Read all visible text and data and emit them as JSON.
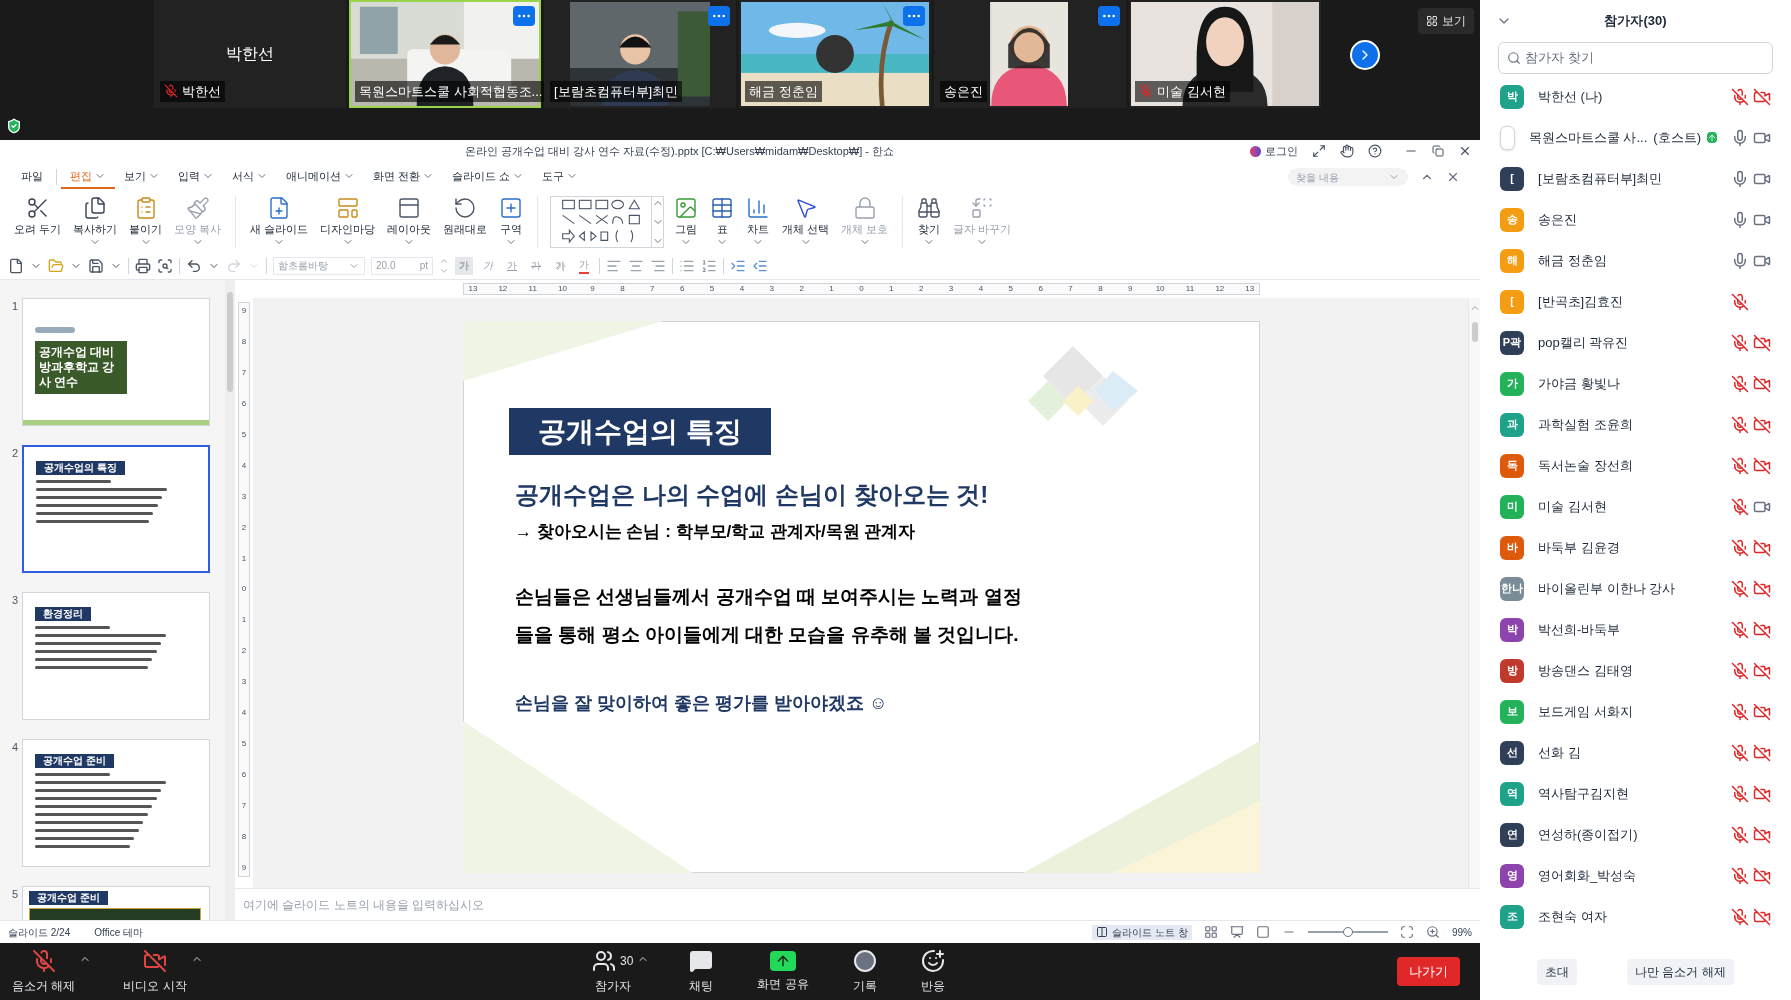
{
  "video_strip": {
    "tiles": [
      {
        "kind": "name",
        "name": "박한선",
        "label": "박한선",
        "muted": true,
        "speaking": false,
        "menu": false
      },
      {
        "kind": "video",
        "label": "목원스마트스쿨 사회적협동조...",
        "muted": false,
        "speaking": true,
        "menu": true
      },
      {
        "kind": "video",
        "label": "[보람초컴퓨터부]최민",
        "muted": false,
        "speaking": false,
        "menu": true
      },
      {
        "kind": "video",
        "label": "해금 정춘임",
        "muted": false,
        "speaking": false,
        "menu": true
      },
      {
        "kind": "video",
        "label": "송은진",
        "muted": false,
        "speaking": false,
        "menu": true
      },
      {
        "kind": "video",
        "label": "미술 김서현",
        "muted": true,
        "speaking": false,
        "menu": false
      }
    ],
    "view_button": "보기"
  },
  "app": {
    "title": "온라인 공개수업 대비 강사 연수 자료(수정).pptx [C:₩Users₩midam₩Desktop₩] - 한쇼",
    "login": "로그인",
    "search_placeholder": "찾을 내용"
  },
  "menu_tabs": [
    {
      "label": "파일",
      "selected": false
    },
    {
      "label": "편집",
      "selected": true
    },
    {
      "label": "보기",
      "selected": false
    },
    {
      "label": "입력",
      "selected": false
    },
    {
      "label": "서식",
      "selected": false
    },
    {
      "label": "애니메이션",
      "selected": false
    },
    {
      "label": "화면 전환",
      "selected": false
    },
    {
      "label": "슬라이드 쇼",
      "selected": false
    },
    {
      "label": "도구",
      "selected": false
    }
  ],
  "ribbon": [
    {
      "kind": "button",
      "label": "오려 두기",
      "disabled": false,
      "dropdown": false
    },
    {
      "kind": "button",
      "label": "복사하기",
      "disabled": false,
      "dropdown": true
    },
    {
      "kind": "button",
      "label": "붙이기",
      "disabled": false,
      "dropdown": true
    },
    {
      "kind": "button",
      "label": "모양 복사",
      "disabled": true,
      "dropdown": true
    },
    {
      "kind": "separator"
    },
    {
      "kind": "button",
      "label": "새 슬라이드",
      "disabled": false,
      "dropdown": true
    },
    {
      "kind": "button",
      "label": "디자인마당",
      "disabled": false,
      "dropdown": true
    },
    {
      "kind": "button",
      "label": "레이아웃",
      "disabled": false,
      "dropdown": true
    },
    {
      "kind": "button",
      "label": "원래대로",
      "disabled": false,
      "dropdown": false
    },
    {
      "kind": "button",
      "label": "구역",
      "disabled": false,
      "dropdown": true
    },
    {
      "kind": "separator"
    },
    {
      "kind": "gallery"
    },
    {
      "kind": "button",
      "label": "그림",
      "disabled": false,
      "dropdown": true
    },
    {
      "kind": "button",
      "label": "표",
      "disabled": false,
      "dropdown": true
    },
    {
      "kind": "button",
      "label": "차트",
      "disabled": false,
      "dropdown": true
    },
    {
      "kind": "button",
      "label": "개체 선택",
      "disabled": false,
      "dropdown": true
    },
    {
      "kind": "button",
      "label": "개체 보호",
      "disabled": true,
      "dropdown": true
    },
    {
      "kind": "separator"
    },
    {
      "kind": "button",
      "label": "찾기",
      "disabled": false,
      "dropdown": true
    },
    {
      "kind": "button",
      "label": "글자 바꾸기",
      "disabled": true,
      "dropdown": true
    }
  ],
  "format_toolbar": {
    "font": "함초롬바탕",
    "size": "20.0",
    "unit": "pt",
    "text_styles": [
      {
        "label": "가",
        "kind": "bold",
        "selected": true
      },
      {
        "label": "가",
        "kind": "italic",
        "selected": false
      },
      {
        "label": "가",
        "kind": "underline",
        "selected": false
      },
      {
        "label": "가",
        "kind": "strike",
        "selected": false
      },
      {
        "label": "가",
        "kind": "shadow",
        "selected": false
      },
      {
        "label": "가",
        "kind": "color",
        "selected": false
      }
    ]
  },
  "thumbnails": [
    {
      "number": "1",
      "kind": "cover",
      "title": "공개수업 대비 방과후학교 강사 연수",
      "selected": false
    },
    {
      "number": "2",
      "kind": "content",
      "title": "공개수업의 특징",
      "selected": true
    },
    {
      "number": "3",
      "kind": "content",
      "title": "환경정리",
      "selected": false
    },
    {
      "number": "4",
      "kind": "content",
      "title": "공개수업 준비",
      "selected": false
    },
    {
      "number": "5",
      "kind": "table",
      "title": "공개수업 준비",
      "selected": false
    }
  ],
  "ruler": {
    "horizontal": [
      "13",
      "12",
      "11",
      "10",
      "9",
      "8",
      "7",
      "6",
      "5",
      "4",
      "3",
      "2",
      "1",
      "0",
      "1",
      "2",
      "3",
      "4",
      "5",
      "6",
      "7",
      "8",
      "9",
      "10",
      "11",
      "12",
      "13"
    ],
    "vertical": [
      "9",
      "8",
      "7",
      "6",
      "5",
      "4",
      "3",
      "2",
      "1",
      "0",
      "1",
      "2",
      "3",
      "4",
      "5",
      "6",
      "7",
      "8",
      "9"
    ]
  },
  "slide": {
    "title": "공개수업의 특징",
    "heading": "공개수업은 나의 수업에 손님이 찾아오는 것!",
    "subline": "→ 찾아오시는 손님 : 학부모/학교 관계자/목원 관계자",
    "paragraph": [
      "손님들은 선생님들께서 공개수업 때 보여주시는 노력과 열정",
      "들을 통해 평소 아이들에게 대한 모습을 유추해 볼 것입니다."
    ],
    "closing": "손님을 잘 맞이하여 좋은 평가를 받아야겠죠 ☺"
  },
  "notes_placeholder": "여기에 슬라이드 노트의 내용을 입력하십시오",
  "status_bar": {
    "slide": "슬라이드 2/24",
    "theme": "Office 테마",
    "notes_button": "슬라이드 노트 창",
    "zoom": "99%",
    "level": 0.5
  },
  "zoom_bar": [
    {
      "kind": "mute",
      "label": "음소거 해제",
      "menu": true
    },
    {
      "kind": "video",
      "label": "비디오 시작",
      "menu": true
    },
    {
      "kind": "participants",
      "label": "참가자",
      "count": "30",
      "menu": true
    },
    {
      "kind": "chat",
      "label": "채팅"
    },
    {
      "kind": "share",
      "label": "화면 공유"
    },
    {
      "kind": "record",
      "label": "기록"
    },
    {
      "kind": "reactions",
      "label": "반응"
    },
    {
      "kind": "leave",
      "label": "나가기"
    }
  ],
  "participants": {
    "title": "참가자(30)",
    "search_placeholder": "참가자 찾기",
    "items": [
      {
        "avatar": "박",
        "color": "#1ea28a",
        "name": "박한선 (나)",
        "muted": true,
        "video_off": true
      },
      {
        "kind": "picture",
        "name": "목원스마트스쿨 사...",
        "role": "(호스트)",
        "sharing": true,
        "muted": false,
        "video_off": false
      },
      {
        "avatar": "[",
        "color": "#2e3f57",
        "name": "[보람초컴퓨터부]최민",
        "muted": false,
        "video_off": false
      },
      {
        "avatar": "송",
        "color": "#f49d12",
        "name": "송은진",
        "muted": false,
        "video_off": false
      },
      {
        "avatar": "해",
        "color": "#f49d12",
        "name": "해금 정춘임",
        "muted": false,
        "video_off": false
      },
      {
        "avatar": "[",
        "color": "#f49d12",
        "name": "[반곡초]김효진",
        "muted": true
      },
      {
        "avatar": "P곽",
        "color": "#2e3f57",
        "name": "pop캘리 곽유진",
        "muted": true,
        "video_off": true
      },
      {
        "avatar": "가",
        "color": "#23b25a",
        "name": "가야금 황빛나",
        "muted": true,
        "video_off": true
      },
      {
        "avatar": "과",
        "color": "#1ea28a",
        "name": "과학실험 조윤희",
        "muted": true,
        "video_off": true
      },
      {
        "avatar": "독",
        "color": "#de5a0a",
        "name": "독서논술 장선희",
        "muted": true,
        "video_off": true
      },
      {
        "avatar": "미",
        "color": "#23b25a",
        "name": "미술 김서현",
        "muted": true,
        "video_off": false
      },
      {
        "avatar": "바",
        "color": "#de5a0a",
        "name": "바둑부 김윤경",
        "muted": true,
        "video_off": true
      },
      {
        "avatar": "한나",
        "color": "#7a8c98",
        "name": "바이올린부 이한나 강사",
        "muted": true,
        "video_off": true
      },
      {
        "avatar": "박",
        "color": "#8e44ad",
        "name": "박선희-바둑부",
        "muted": true,
        "video_off": true
      },
      {
        "avatar": "방",
        "color": "#c0392b",
        "name": "방송댄스 김태영",
        "muted": true,
        "video_off": true
      },
      {
        "avatar": "보",
        "color": "#23b25a",
        "name": "보드게임 서화지",
        "muted": true,
        "video_off": true
      },
      {
        "avatar": "선",
        "color": "#2e3f57",
        "name": "선화 김",
        "muted": true,
        "video_off": true
      },
      {
        "avatar": "역",
        "color": "#1ea28a",
        "name": "역사탐구김지현",
        "muted": true,
        "video_off": true
      },
      {
        "avatar": "연",
        "color": "#2e3f57",
        "name": "연성하(종이접기)",
        "muted": true,
        "video_off": true
      },
      {
        "avatar": "영",
        "color": "#8e44ad",
        "name": "영어회화_박성숙",
        "muted": true,
        "video_off": true
      },
      {
        "avatar": "조",
        "color": "#1ea28a",
        "name": "조현숙 여자",
        "muted": true,
        "video_off": true
      }
    ],
    "buttons": [
      "초대",
      "나만 음소거 해제"
    ]
  }
}
